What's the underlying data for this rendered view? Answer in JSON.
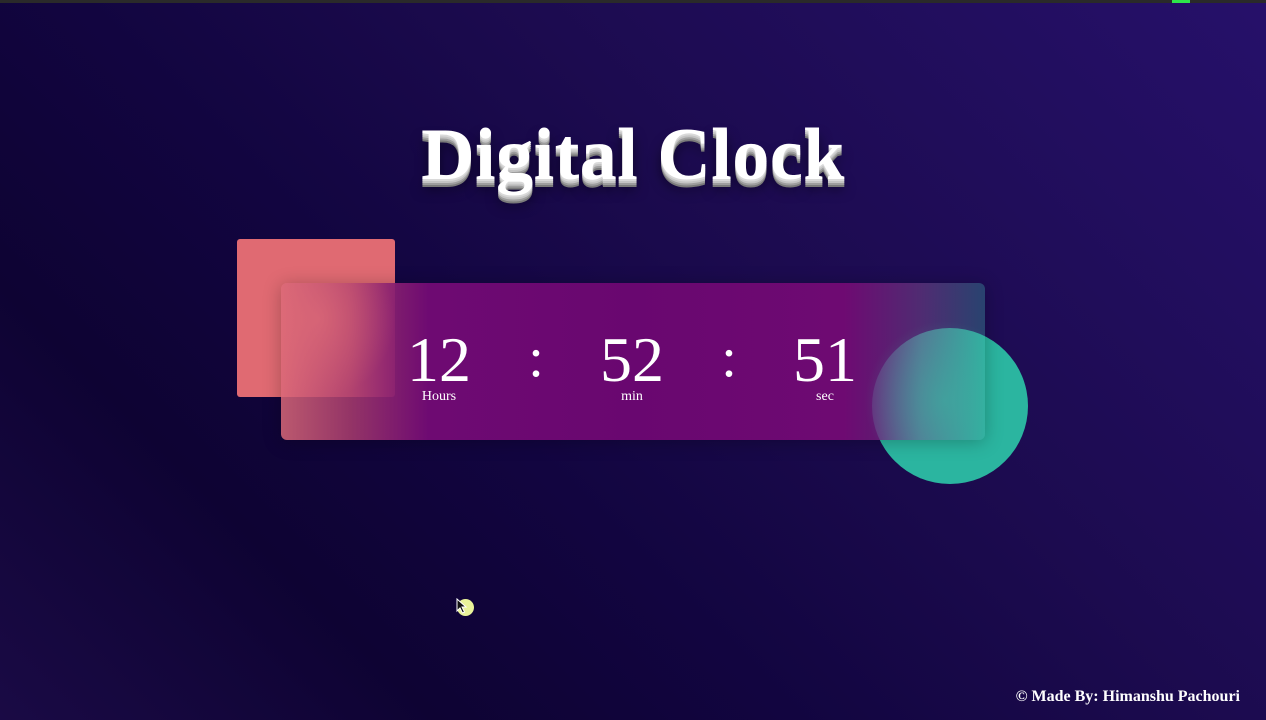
{
  "page": {
    "title": "Digital Clock",
    "footer": "© Made By: Himanshu Pachouri"
  },
  "clock": {
    "hours": "12",
    "minutes": "52",
    "seconds": "51",
    "separator": ":",
    "hours_label": "Hours",
    "minutes_label": "min",
    "seconds_label": "sec"
  },
  "colors": {
    "background": "#1a0a4a",
    "panel": "#6a0870",
    "square": "#e06a72",
    "circle": "#2bb5a0",
    "text": "#ffffff"
  },
  "icons": {
    "cursor": "pointer-cursor-icon"
  }
}
